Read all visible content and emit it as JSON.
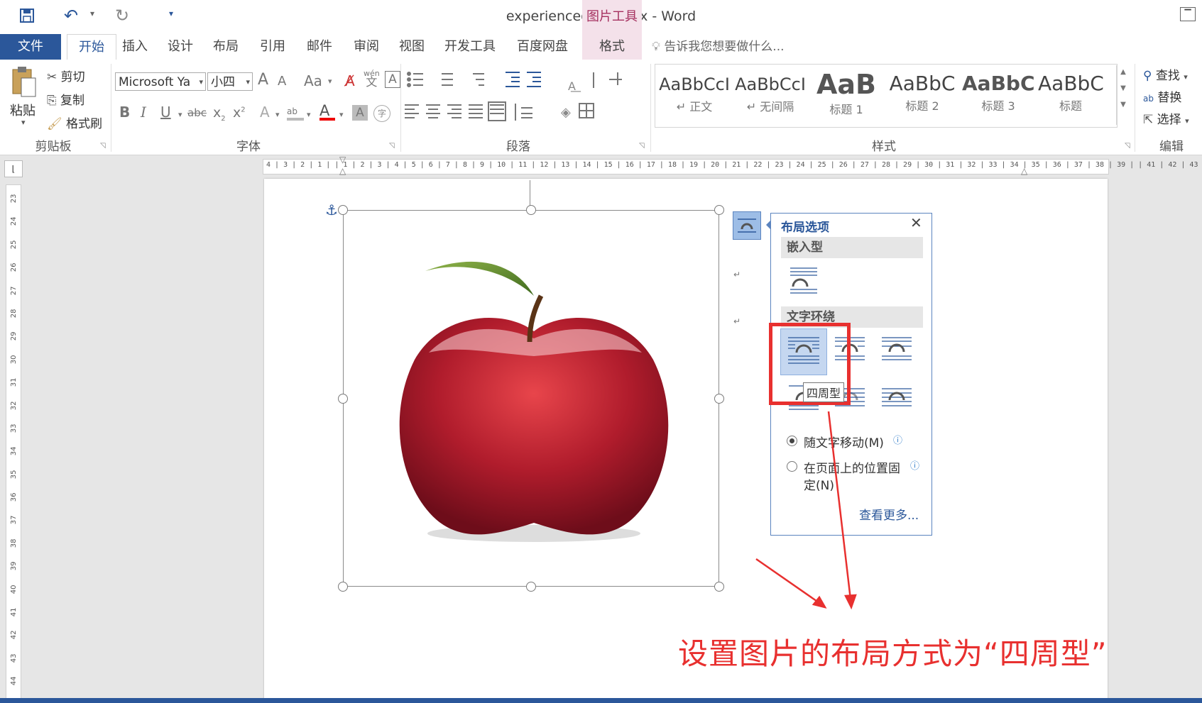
{
  "titlebar": {
    "doc_title": "experiencedata.docx - Word",
    "contextual_group": "图片工具"
  },
  "tabs": {
    "file": "文件",
    "home": "开始",
    "insert": "插入",
    "design": "设计",
    "layout": "布局",
    "references": "引用",
    "mailings": "邮件",
    "review": "审阅",
    "view": "视图",
    "developer": "开发工具",
    "baidu": "百度网盘",
    "format": "格式",
    "tell_me": "告诉我您想要做什么..."
  },
  "clipboard": {
    "paste": "粘贴",
    "cut": "剪切",
    "copy": "复制",
    "format_painter": "格式刷",
    "group_label": "剪贴板"
  },
  "font": {
    "font_name": "Microsoft Ya",
    "font_size": "小四",
    "grow": "A",
    "shrink": "A",
    "change_case": "Aa",
    "phonetic": "wén",
    "phonetic_char": "文",
    "char_border": "A",
    "bold": "B",
    "italic": "I",
    "underline": "U",
    "strike": "abc",
    "subscript": "x",
    "superscript": "x",
    "text_effects": "A",
    "highlight": "ab",
    "font_color": "A",
    "char_shading": "A",
    "enclose": "字",
    "group_label": "字体"
  },
  "paragraph": {
    "group_label": "段落"
  },
  "styles": {
    "items": [
      {
        "sample": "AaBbCcI",
        "name": "↵ 正文"
      },
      {
        "sample": "AaBbCcI",
        "name": "↵ 无间隔"
      },
      {
        "sample": "AaB",
        "name": "标题 1"
      },
      {
        "sample": "AaBbC",
        "name": "标题 2"
      },
      {
        "sample": "AaBbC",
        "name": "标题 3"
      },
      {
        "sample": "AaBbC",
        "name": "标题"
      }
    ],
    "group_label": "样式"
  },
  "editing": {
    "find": "查找",
    "replace": "替换",
    "select": "选择",
    "group_label": "编辑"
  },
  "ruler": {
    "h_ticks": "4 | 3 | 2 | 1 |   | 1 | 2 | 3 | 4 | 5 | 6 | 7 | 8 | 9 | 10 | 11 | 12 | 13 | 14 | 15 | 16 | 17 | 18 | 19 | 20 | 21 | 22 | 23 | 24 | 25 | 26 | 27 | 28 | 29 | 30 | 31 | 32 | 33 | 34 | 35 | 36 | 37 | 38 | 39 |   | 41 | 42 | 43 | 44",
    "v_ticks": [
      "23",
      "24",
      "25",
      "26",
      "27",
      "28",
      "29",
      "30",
      "31",
      "32",
      "33",
      "34",
      "35",
      "36",
      "37",
      "38",
      "39",
      "40",
      "41",
      "42",
      "43",
      "44"
    ]
  },
  "layout_options": {
    "title": "布局选项",
    "inline_section": "嵌入型",
    "wrap_section": "文字环绕",
    "tooltip": "四周型",
    "option_move": "随文字移动(M)",
    "option_fixed_line1": "在页面上的位置固",
    "option_fixed_line2": "定(N)",
    "see_more": "查看更多..."
  },
  "annotation": {
    "caption": "设置图片的布局方式为“四周型”",
    "color": "#e8302f"
  },
  "colors": {
    "accent": "#2b579a",
    "contextual": "#a5305f"
  }
}
